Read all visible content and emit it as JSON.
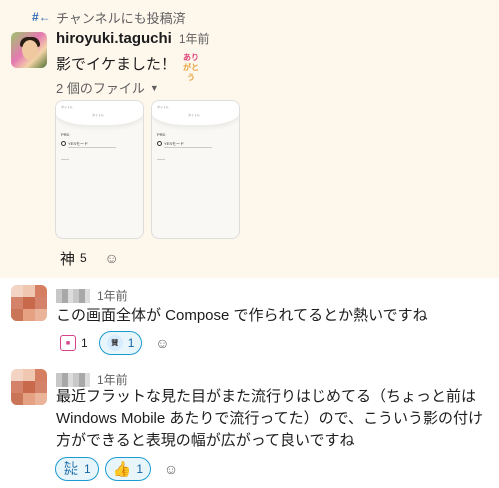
{
  "broadcast": {
    "icon": "broadcast-icon",
    "text": "チャンネルにも投稿済"
  },
  "message_main": {
    "username": "hiroyuki.taguchi",
    "time": "1年前",
    "text": "影でイケました！",
    "emoji_lines": [
      "あり",
      "がとう"
    ],
    "files_label": "2 個のファイル",
    "file_thumb": {
      "title": "タイトル",
      "heading": "タイトル",
      "section": "PRD",
      "option": "YESモード"
    },
    "reactions": [
      {
        "emoji": "神",
        "count": "5"
      }
    ]
  },
  "reply1": {
    "time": "1年前",
    "text": "この画面全体が Compose で作られてるとか熱いですね",
    "reactions": [
      {
        "emoji": "emoji-pink-icon",
        "count": "1",
        "mine": false
      },
      {
        "emoji": "emoji-sansei-icon",
        "count": "1",
        "mine": true
      }
    ]
  },
  "reply2": {
    "time": "1年前",
    "text": "最近フラットな見た目がまた流行りはじめてる（ちょっと前は Windows Mobile あたりで流行ってた）ので、こういう影の付け方ができると表現の幅が広がって良いですね",
    "reactions": [
      {
        "emoji": "emoji-tashikani-icon",
        "count": "1",
        "mine": true
      },
      {
        "emoji": "thumbs-up-icon",
        "count": "1",
        "mine": true
      }
    ]
  },
  "colors": {
    "highlight": "#fdf7ec",
    "accent": "#1264a3",
    "muted": "#616061"
  }
}
